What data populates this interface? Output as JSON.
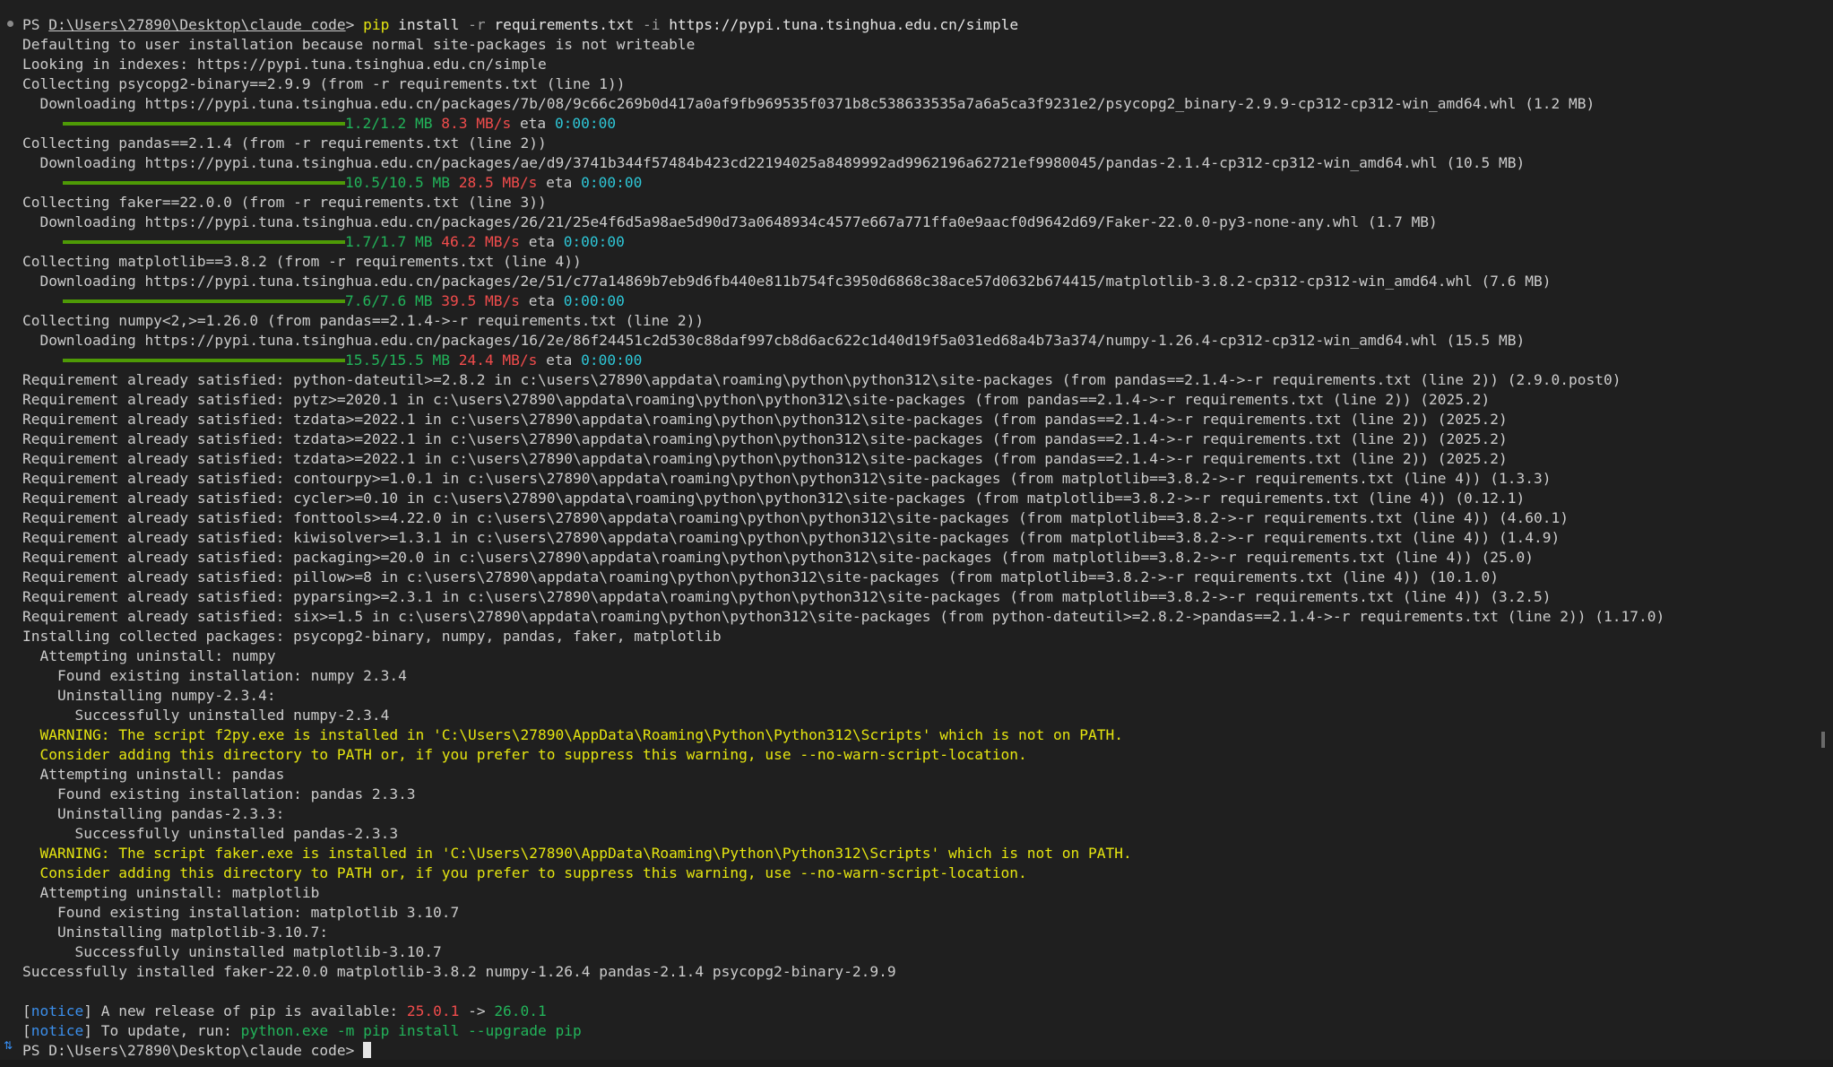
{
  "terminal": {
    "prompt_prefix": "PS ",
    "prompt_path": "D:\\Users\\27890\\Desktop\\claude code",
    "prompt_suffix": "> ",
    "command_name": "pip",
    "command_rest": " install ",
    "command_flag_r": "-r",
    "command_file": " requirements.txt ",
    "command_flag_i": "-i",
    "command_url": " https://pypi.tuna.tsinghua.edu.cn/simple",
    "lines_before_downloads": [
      "Defaulting to user installation because normal site-packages is not writeable",
      "Looking in indexes: https://pypi.tuna.tsinghua.edu.cn/simple"
    ],
    "downloads": [
      {
        "collecting": "Collecting psycopg2-binary==2.9.9 (from -r requirements.txt (line 1))",
        "url": "  Downloading https://pypi.tuna.tsinghua.edu.cn/packages/7b/08/9c66c269b0d417a0af9fb969535f0371b8c538633535a7a6a5ca3f9231e2/psycopg2_binary-2.9.9-cp312-cp312-win_amd64.whl (1.2 MB)",
        "progress": 1.0,
        "size": "1.2/1.2 MB",
        "speed": "8.3 MB/s",
        "eta_label": "eta",
        "eta": "0:00:00"
      },
      {
        "collecting": "Collecting pandas==2.1.4 (from -r requirements.txt (line 2))",
        "url": "  Downloading https://pypi.tuna.tsinghua.edu.cn/packages/ae/d9/3741b344f57484b423cd22194025a8489992ad9962196a62721ef9980045/pandas-2.1.4-cp312-cp312-win_amd64.whl (10.5 MB)",
        "progress": 1.0,
        "size": "10.5/10.5 MB",
        "speed": "28.5 MB/s",
        "eta_label": "eta",
        "eta": "0:00:00"
      },
      {
        "collecting": "Collecting faker==22.0.0 (from -r requirements.txt (line 3))",
        "url": "  Downloading https://pypi.tuna.tsinghua.edu.cn/packages/26/21/25e4f6d5a98ae5d90d73a0648934c4577e667a771ffa0e9aacf0d9642d69/Faker-22.0.0-py3-none-any.whl (1.7 MB)",
        "progress": 1.0,
        "size": "1.7/1.7 MB",
        "speed": "46.2 MB/s",
        "eta_label": "eta",
        "eta": "0:00:00"
      },
      {
        "collecting": "Collecting matplotlib==3.8.2 (from -r requirements.txt (line 4))",
        "url": "  Downloading https://pypi.tuna.tsinghua.edu.cn/packages/2e/51/c77a14869b7eb9d6fb440e811b754fc3950d6868c38ace57d0632b674415/matplotlib-3.8.2-cp312-cp312-win_amd64.whl (7.6 MB)",
        "progress": 1.0,
        "size": "7.6/7.6 MB",
        "speed": "39.5 MB/s",
        "eta_label": "eta",
        "eta": "0:00:00"
      },
      {
        "collecting": "Collecting numpy<2,>=1.26.0 (from pandas==2.1.4->-r requirements.txt (line 2))",
        "url": "  Downloading https://pypi.tuna.tsinghua.edu.cn/packages/16/2e/86f24451c2d530c88daf997cb8d6ac622c1d40d19f5a031ed68a4b73a374/numpy-1.26.4-cp312-cp312-win_amd64.whl (15.5 MB)",
        "progress": 1.0,
        "size": "15.5/15.5 MB",
        "speed": "24.4 MB/s",
        "eta_label": "eta",
        "eta": "0:00:00"
      }
    ],
    "plain_lines": [
      "Requirement already satisfied: python-dateutil>=2.8.2 in c:\\users\\27890\\appdata\\roaming\\python\\python312\\site-packages (from pandas==2.1.4->-r requirements.txt (line 2)) (2.9.0.post0)",
      "Requirement already satisfied: pytz>=2020.1 in c:\\users\\27890\\appdata\\roaming\\python\\python312\\site-packages (from pandas==2.1.4->-r requirements.txt (line 2)) (2025.2)",
      "Requirement already satisfied: tzdata>=2022.1 in c:\\users\\27890\\appdata\\roaming\\python\\python312\\site-packages (from pandas==2.1.4->-r requirements.txt (line 2)) (2025.2)",
      "Requirement already satisfied: tzdata>=2022.1 in c:\\users\\27890\\appdata\\roaming\\python\\python312\\site-packages (from pandas==2.1.4->-r requirements.txt (line 2)) (2025.2)",
      "Requirement already satisfied: tzdata>=2022.1 in c:\\users\\27890\\appdata\\roaming\\python\\python312\\site-packages (from pandas==2.1.4->-r requirements.txt (line 2)) (2025.2)",
      "Requirement already satisfied: contourpy>=1.0.1 in c:\\users\\27890\\appdata\\roaming\\python\\python312\\site-packages (from matplotlib==3.8.2->-r requirements.txt (line 4)) (1.3.3)",
      "Requirement already satisfied: cycler>=0.10 in c:\\users\\27890\\appdata\\roaming\\python\\python312\\site-packages (from matplotlib==3.8.2->-r requirements.txt (line 4)) (0.12.1)",
      "Requirement already satisfied: fonttools>=4.22.0 in c:\\users\\27890\\appdata\\roaming\\python\\python312\\site-packages (from matplotlib==3.8.2->-r requirements.txt (line 4)) (4.60.1)",
      "Requirement already satisfied: kiwisolver>=1.3.1 in c:\\users\\27890\\appdata\\roaming\\python\\python312\\site-packages (from matplotlib==3.8.2->-r requirements.txt (line 4)) (1.4.9)",
      "Requirement already satisfied: packaging>=20.0 in c:\\users\\27890\\appdata\\roaming\\python\\python312\\site-packages (from matplotlib==3.8.2->-r requirements.txt (line 4)) (25.0)",
      "Requirement already satisfied: pillow>=8 in c:\\users\\27890\\appdata\\roaming\\python\\python312\\site-packages (from matplotlib==3.8.2->-r requirements.txt (line 4)) (10.1.0)",
      "Requirement already satisfied: pyparsing>=2.3.1 in c:\\users\\27890\\appdata\\roaming\\python\\python312\\site-packages (from matplotlib==3.8.2->-r requirements.txt (line 4)) (3.2.5)",
      "Requirement already satisfied: six>=1.5 in c:\\users\\27890\\appdata\\roaming\\python\\python312\\site-packages (from python-dateutil>=2.8.2->pandas==2.1.4->-r requirements.txt (line 2)) (1.17.0)",
      "Installing collected packages: psycopg2-binary, numpy, pandas, faker, matplotlib",
      "  Attempting uninstall: numpy",
      "    Found existing installation: numpy 2.3.4",
      "    Uninstalling numpy-2.3.4:",
      "      Successfully uninstalled numpy-2.3.4"
    ],
    "warning_1": [
      "  WARNING: The script f2py.exe is installed in 'C:\\Users\\27890\\AppData\\Roaming\\Python\\Python312\\Scripts' which is not on PATH.",
      "  Consider adding this directory to PATH or, if you prefer to suppress this warning, use --no-warn-script-location."
    ],
    "pandas_lines": [
      "  Attempting uninstall: pandas",
      "    Found existing installation: pandas 2.3.3",
      "    Uninstalling pandas-2.3.3:",
      "      Successfully uninstalled pandas-2.3.3"
    ],
    "warning_2": [
      "  WARNING: The script faker.exe is installed in 'C:\\Users\\27890\\AppData\\Roaming\\Python\\Python312\\Scripts' which is not on PATH.",
      "  Consider adding this directory to PATH or, if you prefer to suppress this warning, use --no-warn-script-location."
    ],
    "matplotlib_lines": [
      "  Attempting uninstall: matplotlib",
      "    Found existing installation: matplotlib 3.10.7",
      "    Uninstalling matplotlib-3.10.7:",
      "      Successfully uninstalled matplotlib-3.10.7",
      "Successfully installed faker-22.0.0 matplotlib-3.8.2 numpy-1.26.4 pandas-2.1.4 psycopg2-binary-2.9.9"
    ],
    "notice_open": "[",
    "notice_word": "notice",
    "notice_close": "]",
    "notice_1_text": " A new release of pip is available: ",
    "notice_1_old": "25.0.1",
    "notice_1_arrow": " -> ",
    "notice_1_new": "26.0.1",
    "notice_2_text": " To update, run: ",
    "notice_2_cmd": "python.exe -m pip install --upgrade pip",
    "final_prompt": "PS D:\\Users\\27890\\Desktop\\claude code> "
  },
  "colors": {
    "background": "#1f1f1f",
    "text": "#cccccc",
    "progress_bar": "#4e9a06",
    "size_green": "#22b45a",
    "speed_red": "#f14c4c",
    "eta_cyan": "#2ec6d6",
    "warning_yellow": "#e5e510",
    "notice_blue": "#3b8eea"
  },
  "icons": {
    "status_icon": "remote-icon",
    "scroll_marker": "scroll-thumb"
  }
}
